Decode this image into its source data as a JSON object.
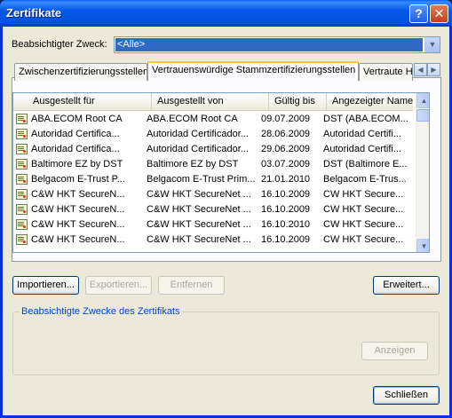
{
  "window": {
    "title": "Zertifikate",
    "help_glyph": "?",
    "close_glyph": "✕"
  },
  "purpose": {
    "label": "Beabsichtigter Zweck:",
    "value": "<Alle>"
  },
  "tabs": [
    {
      "label": "Zwischenzertifizierungsstellen",
      "active": false
    },
    {
      "label": "Vertrauenswürdige Stammzertifizierungsstellen",
      "active": true
    },
    {
      "label": "Vertraute Herausgeber",
      "active": false
    }
  ],
  "table": {
    "columns": [
      "Ausgestellt für",
      "Ausgestellt von",
      "Gültig bis",
      "Angezeigter Name"
    ],
    "rows": [
      [
        "ABA.ECOM Root CA",
        "ABA.ECOM Root CA",
        "09.07.2009",
        "DST (ABA.ECOM..."
      ],
      [
        "Autoridad Certifica...",
        "Autoridad Certificador...",
        "28.06.2009",
        "Autoridad Certifi..."
      ],
      [
        "Autoridad Certifica...",
        "Autoridad Certificador...",
        "29.06.2009",
        "Autoridad Certifi..."
      ],
      [
        "Baltimore EZ by DST",
        "Baltimore EZ by DST",
        "03.07.2009",
        "DST (Baltimore E..."
      ],
      [
        "Belgacom E-Trust P...",
        "Belgacom E-Trust Prim...",
        "21.01.2010",
        "Belgacom E-Trus..."
      ],
      [
        "C&W HKT SecureN...",
        "C&W HKT SecureNet ...",
        "16.10.2009",
        "CW HKT Secure..."
      ],
      [
        "C&W HKT SecureN...",
        "C&W HKT SecureNet ...",
        "16.10.2009",
        "CW HKT Secure..."
      ],
      [
        "C&W HKT SecureN...",
        "C&W HKT SecureNet ...",
        "16.10.2010",
        "CW HKT Secure..."
      ],
      [
        "C&W HKT SecureN...",
        "C&W HKT SecureNet ...",
        "16.10.2009",
        "CW HKT Secure..."
      ]
    ]
  },
  "buttons": {
    "import": "Importieren...",
    "export": "Exportieren...",
    "remove": "Entfernen",
    "advanced": "Erweitert...",
    "view": "Anzeigen",
    "close": "Schließen"
  },
  "group": {
    "label": "Beabsichtigte Zwecke des Zertifikats"
  }
}
